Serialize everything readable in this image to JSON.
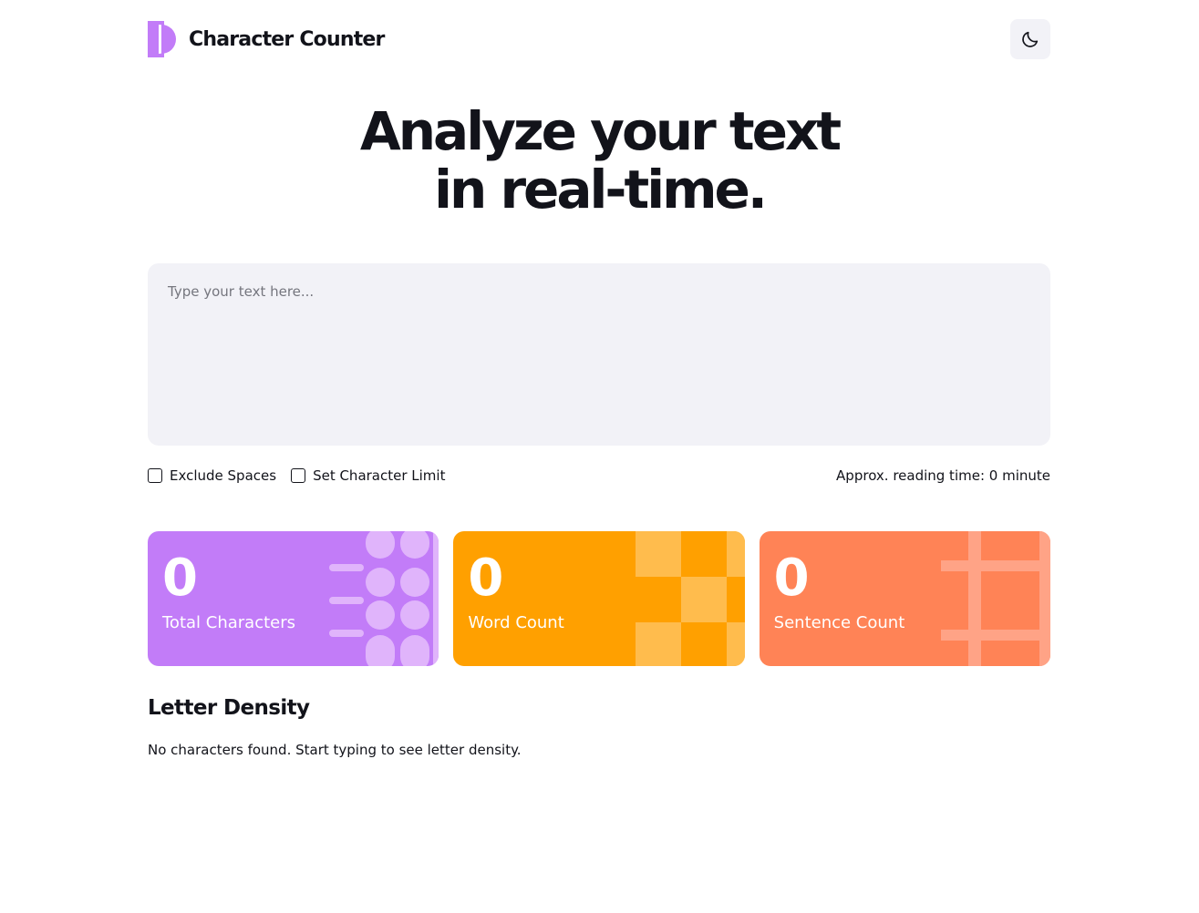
{
  "app": {
    "title": "Character Counter"
  },
  "header": {
    "theme_toggle_icon": "moon-icon"
  },
  "hero": {
    "line1": "Analyze your text",
    "line2": "in real-time."
  },
  "input": {
    "placeholder": "Type your text here...",
    "value": ""
  },
  "options": {
    "exclude_spaces": {
      "label": "Exclude Spaces",
      "checked": false
    },
    "character_limit": {
      "label": "Set Character Limit",
      "checked": false
    },
    "reading_time": "Approx. reading time: 0 minute"
  },
  "stats": [
    {
      "value": "0",
      "label": "Total Characters",
      "color": "#c27cf8"
    },
    {
      "value": "0",
      "label": "Word Count",
      "color": "#ffa000"
    },
    {
      "value": "0",
      "label": "Sentence Count",
      "color": "#ff8356"
    }
  ],
  "letter_density": {
    "title": "Letter Density",
    "empty_message": "No characters found. Start typing to see letter density."
  },
  "colors": {
    "text": "#12131a",
    "surface": "#f2f2f7",
    "accent_purple": "#c27cf8",
    "accent_orange": "#ffa000",
    "accent_coral": "#ff8356"
  }
}
